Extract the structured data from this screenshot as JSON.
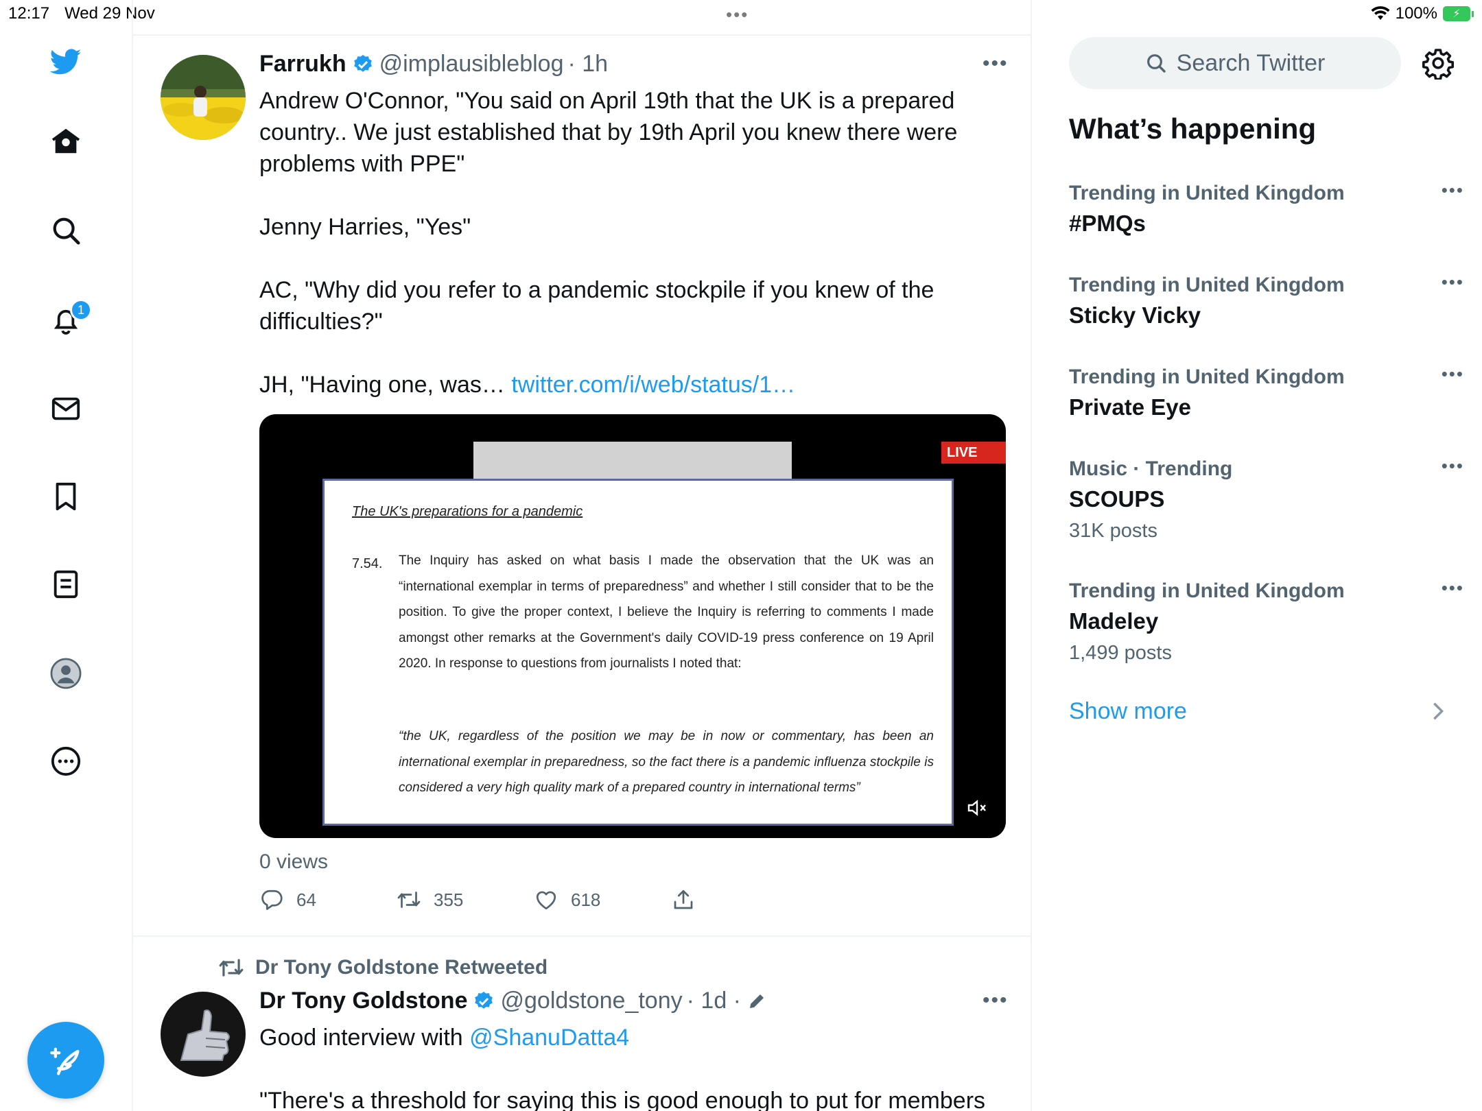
{
  "status_bar": {
    "time": "12:17",
    "date": "Wed 29 Nov",
    "battery": "100%",
    "multitask": "•••"
  },
  "nav": {
    "items": [
      "logo",
      "home",
      "explore",
      "notifications",
      "messages",
      "bookmarks",
      "lists",
      "profile",
      "more"
    ],
    "notifications_count": "1"
  },
  "tweet1": {
    "display_name": "Farrukh",
    "handle": "@implausibleblog",
    "time": "· 1h",
    "more": "•••",
    "text_main": "Andrew O'Connor, \"You said on April 19th that the UK is a prepared country.. We just established that by 19th April you knew there were problems with PPE\"\n\nJenny Harries, \"Yes\"\n\nAC, \"Why did you refer to a pandemic stockpile if you knew of the difficulties?\"\n\nJH, \"Having one, was… ",
    "text_link": "twitter.com/i/web/status/1…",
    "media": {
      "doc_heading": "The UK's preparations for a pandemic",
      "doc_number": "7.54.",
      "doc_paragraph": "The Inquiry has asked on what basis I made the observation that the UK was an “international exemplar in terms of preparedness” and whether I still consider that to be the position. To give the proper context, I believe the Inquiry is referring to comments I made amongst other remarks at the Government's daily COVID-19 press conference on 19 April 2020. In response to questions from journalists I noted that:",
      "doc_quote": "“the UK, regardless of the position we may be in now or commentary, has been an international exemplar in preparedness, so the fact there is a pandemic influenza stockpile is considered a very high quality mark of a prepared country in international terms”",
      "live_label": "LIVE"
    },
    "views": "0 views",
    "replies": "64",
    "retweets": "355",
    "likes": "618"
  },
  "tweet2": {
    "retweeted_by": "Dr Tony Goldstone Retweeted",
    "display_name": "Dr Tony Goldstone",
    "handle": "@goldstone_tony",
    "time": "· 1d ·",
    "more": "•••",
    "text_prefix": "Good interview with ",
    "mention": "@ShanuDatta4",
    "text_line2": "\"There's a threshold for saying this is good enough to put for members"
  },
  "sidebar": {
    "search_placeholder": "Search Twitter",
    "section_title": "What’s happening",
    "trends": [
      {
        "context": "Trending in United Kingdom",
        "name": "#PMQs",
        "count": ""
      },
      {
        "context": "Trending in United Kingdom",
        "name": "Sticky Vicky",
        "count": ""
      },
      {
        "context": "Trending in United Kingdom",
        "name": "Private Eye",
        "count": ""
      },
      {
        "context": "Music · Trending",
        "name": "SCOUPS",
        "count": "31K posts"
      },
      {
        "context": "Trending in United Kingdom",
        "name": "Madeley",
        "count": "1,499 posts"
      }
    ],
    "trend_more": "•••",
    "show_more": "Show more"
  },
  "colors": {
    "accent": "#1d9bf0",
    "text_primary": "#0f1419",
    "text_secondary": "#536471",
    "battery": "#34c759",
    "live": "#d7261e"
  }
}
